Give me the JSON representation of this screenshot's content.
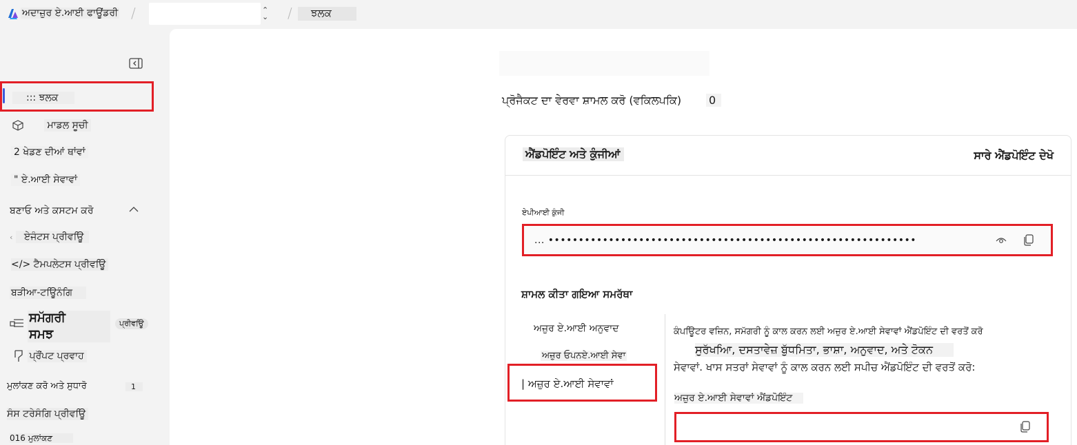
{
  "header": {
    "brand": "ਅਦਾਜ਼ੁਰ ਏ.ਆਈ ਫਾਊਂਡਰੀ",
    "project_selector": "",
    "breadcrumb_current": "ਝਲਕ"
  },
  "sidebar": {
    "items": [
      {
        "label": "::: ਝਲਕ",
        "icon": "grid-icon",
        "active": true
      },
      {
        "label": "ਮਾਡਲ ਸੂਚੀ",
        "icon": "cube-icon"
      },
      {
        "label": "2 ਖੇਡਣ ਦੀਆਂ ਥਾਂਵਾਂ",
        "icon": "playground-icon"
      },
      {
        "label": "\" ਏ.ਆਈ ਸੇਵਾਵਾਂ",
        "icon": "ai-services-icon"
      }
    ],
    "section": {
      "title": "ਬਣਾਓ ਅਤੇ ਕਸਟਮ ਕਰੋ",
      "items": [
        {
          "label": "ਏਜੰਟਸ ਪ੍ਰੀਵਊਿ",
          "icon": "agents-icon"
        },
        {
          "label": "</> ਟੈਮਪਲੇਟਸ ਪ੍ਰੀਵਊਿ",
          "icon": "code-icon"
        },
        {
          "label": "ਬੜੀਆ-ਟਊਿਨੰਗਿ",
          "icon": "fine-tune-icon"
        },
        {
          "label_line1": "ਸਮੱਗਰੀ",
          "label_line2": "ਸਮਝ",
          "badge": "ਪ੍ਰੀਵਊਿ",
          "icon": "content-icon"
        },
        {
          "label": "ਪ੍ਰੌਂਪਟ ਪ੍ਰਵਾਹ",
          "icon": "prompt-flow-icon"
        }
      ]
    },
    "bottom_items": [
      {
        "label": "ਮੁਲਾਂਕਣ ਕਰੋ ਅਤੇ ਸੁਧਾਰੋ",
        "count": "1"
      },
      {
        "label": "ਸੰਸ ਟਰੇਸੰਗਿ ਪ੍ਰੀਵਊਿ"
      },
      {
        "label": "016 ਮੁਲਾਂਕਣ"
      }
    ]
  },
  "main": {
    "description_label": "ਪ੍ਰੋਜੈਕਟ ਦਾ ਵੇਰਵਾ ਸ਼ਾਮਲ ਕਰੋ (ਵਕਿਲਪਕਿ)",
    "description_count": "0",
    "endpoints_card": {
      "title": "ਐਂਡਪੋਇੰਟ ਅਤੇ ਕੁੰਜੀਆਂ",
      "view_all": "ਸਾਰੇ ਐਂਡਪੋਇੰਟ ਦੇਖੋ",
      "api_key_label": "ਏਪੀਆਈ ਕੁੰਜੀ",
      "api_key_masked": "... •••••••••••••••••••••••••••••••••••••••••••••••••••••••••••••",
      "capabilities_title": "ਸ਼ਾਮਲ ਕੀਤਾ ਗਇਆ ਸਮਰੱਥਾ",
      "capabilities": [
        "ਅਜ਼ੁਰ ਏ.ਆਈ ਅਨੁਵਾਦ",
        "ਅਜ਼ੁਰ ਓਪਨਏ.ਆਈ ਸੇਵਾ",
        "| ਅਜ਼ੁਰ ਏ.ਆਈ ਸੇਵਾਵਾਂ"
      ],
      "selected_capability_index": 2,
      "capability_description_1": "ਕੰਪਊਿਟਰ ਵਜ਼ਿਨ, ਸਮੱਗਰੀ ਨੂੰ ਕਾਲ ਕਰਨ ਲਈ ਅਜ਼ੁਰ ਏ.ਆਈ ਸੇਵਾਵਾਂ ਐਂਡਪੋਇੰਟ ਦੀ ਵਰਤੋਂ ਕਰੋ",
      "capability_description_2": "ਸੁਰੱਖਆਿ, ਦਸਤਾਵੇਜ਼ ਬੁੱਧਮਿਤਾ, ਭਾਸ਼ਾ, ਅਨੁਵਾਦ, ਅਤੇ ਟੋਕਨ",
      "capability_description_3": "ਸੇਵਾਵਾਂ. ਖਾਸ ਸਤਰਾਂ ਸੇਵਾਵਾਂ ਨੂੰ ਕਾਲ ਕਰਨ ਲਈ ਸਪੀਚ ਐਂਡਪੋਇੰਟ ਦੀ ਵਰਤੋਂ ਕਰੋ:",
      "endpoint_label": "ਅਜ਼ੁਰ ਏ.ਆਈ ਸੇਵਾਵਾਂ ਐਂਡਪੋਇੰਟ",
      "endpoint_value": ""
    }
  },
  "colors": {
    "highlight_red": "#e21f26",
    "accent_blue": "#3b5bdb",
    "page_bg": "#f3f3f3"
  }
}
